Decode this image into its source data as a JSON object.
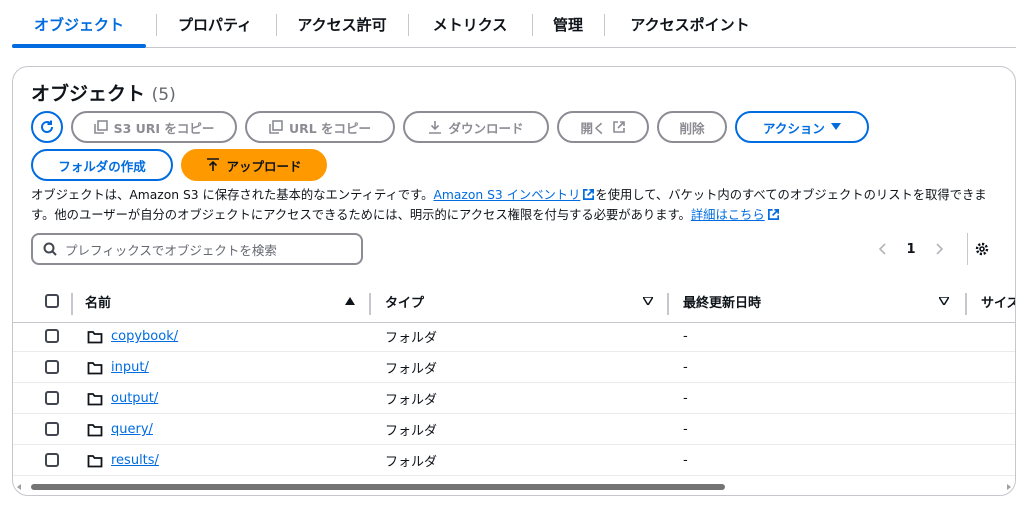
{
  "tabs": [
    {
      "label": "オブジェクト",
      "active": true
    },
    {
      "label": "プロパティ"
    },
    {
      "label": "アクセス許可"
    },
    {
      "label": "メトリクス"
    },
    {
      "label": "管理"
    },
    {
      "label": "アクセスポイント"
    }
  ],
  "panel": {
    "title": "オブジェクト",
    "count": "(5)"
  },
  "toolbar": {
    "refresh_icon": "refresh-icon",
    "copy_s3_uri": "S3 URI をコピー",
    "copy_url": "URL をコピー",
    "download": "ダウンロード",
    "open": "開く",
    "delete": "削除",
    "actions": "アクション",
    "create_folder": "フォルダの作成",
    "upload": "アップロード"
  },
  "description": {
    "part1": "オブジェクトは、Amazon S3 に保存された基本的なエンティティです。",
    "link1": "Amazon S3 インベントリ",
    "part2": "を使用して、バケット内のすべてのオブジェクトのリストを取得できます。他のユーザーが自分のオブジェクトにアクセスできるためには、明示的にアクセス権限を付与する必要があります。",
    "link2": "詳細はこちら"
  },
  "search": {
    "placeholder": "プレフィックスでオブジェクトを検索"
  },
  "pagination": {
    "current_page": "1"
  },
  "table": {
    "columns": {
      "name": "名前",
      "type": "タイプ",
      "last_modified": "最終更新日時",
      "size": "サイズ"
    },
    "rows": [
      {
        "name": "copybook/",
        "type": "フォルダ",
        "last_modified": "-"
      },
      {
        "name": "input/",
        "type": "フォルダ",
        "last_modified": "-"
      },
      {
        "name": "output/",
        "type": "フォルダ",
        "last_modified": "-"
      },
      {
        "name": "query/",
        "type": "フォルダ",
        "last_modified": "-"
      },
      {
        "name": "results/",
        "type": "フォルダ",
        "last_modified": "-"
      }
    ]
  },
  "colors": {
    "accent": "#006ce0",
    "upload": "#ff9900",
    "disabled": "#8c8c94"
  }
}
